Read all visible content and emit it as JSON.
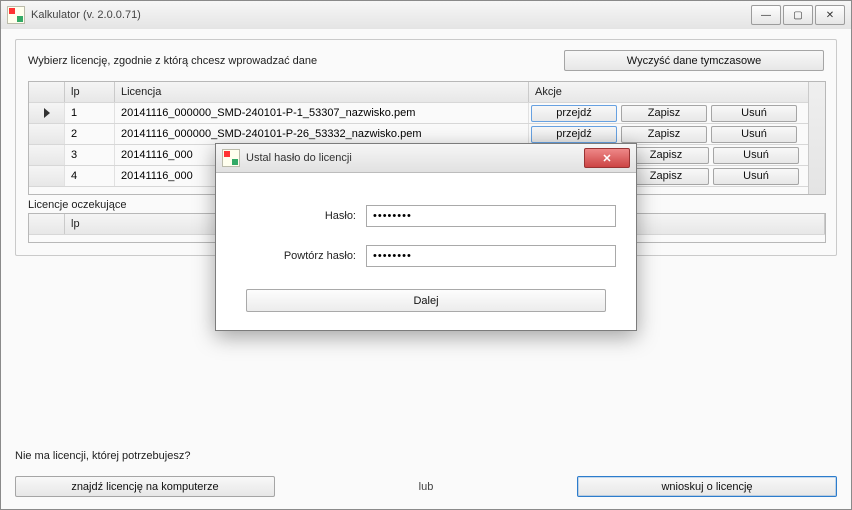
{
  "window": {
    "title": "Kalkulator (v. 2.0.0.71)",
    "min_icon": "—",
    "max_icon": "▢",
    "close_icon": "✕"
  },
  "main": {
    "instruction": "Wybierz licencję, zgodnie z którą chcesz wprowadzać dane",
    "clear_temp": "Wyczyść dane tymczasowe",
    "grid": {
      "headers": {
        "lp": "lp",
        "licencja": "Licencja",
        "akcje": "Akcje"
      },
      "rows": [
        {
          "lp": "1",
          "lic": "20141116_000000_SMD-240101-P-1_53307_nazwisko.pem",
          "go": "przejdź",
          "save": "Zapisz",
          "del": "Usuń"
        },
        {
          "lp": "2",
          "lic": "20141116_000000_SMD-240101-P-26_53332_nazwisko.pem",
          "go": "przejdź",
          "save": "Zapisz",
          "del": "Usuń"
        },
        {
          "lp": "3",
          "lic": "20141116_000",
          "go": "",
          "save": "Zapisz",
          "del": "Usuń"
        },
        {
          "lp": "4",
          "lic": "20141116_000",
          "go": "",
          "save": "Zapisz",
          "del": "Usuń"
        }
      ]
    },
    "pending_label": "Licencje oczekujące",
    "pending_header_lp": "lp"
  },
  "bottom": {
    "question": "Nie ma licencji, której potrzebujesz?",
    "find": "znajdź licencję na komputerze",
    "or": "lub",
    "request": "wnioskuj o licencję"
  },
  "dialog": {
    "title": "Ustal hasło do licencji",
    "pass_label": "Hasło:",
    "repeat_label": "Powtórz hasło:",
    "pass_value": "********",
    "repeat_value": "********",
    "next": "Dalej",
    "close_icon": "✕"
  }
}
